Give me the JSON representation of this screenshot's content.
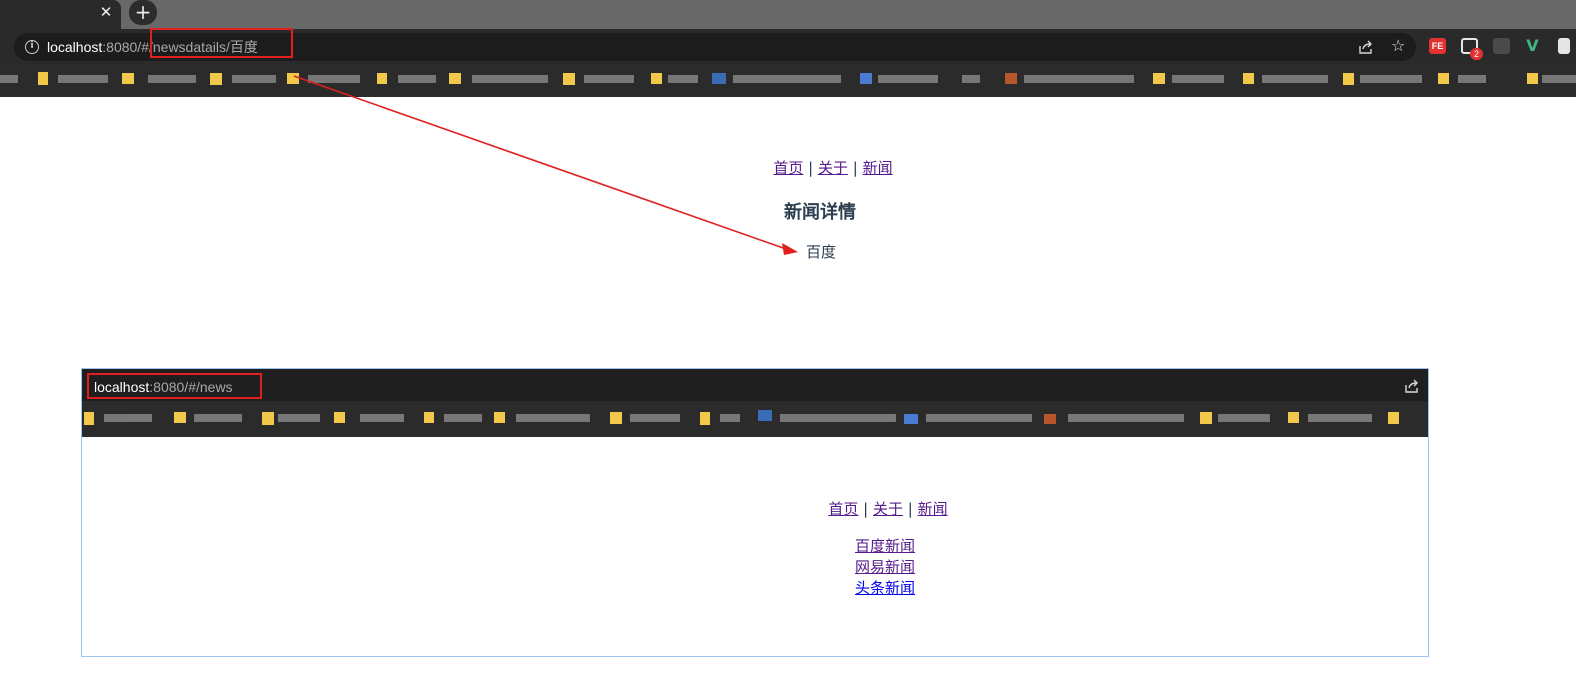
{
  "browser": {
    "tab_close_glyph": "✕",
    "new_tab_glyph": "+",
    "address": {
      "host": "localhost",
      "rest": ":8080/#/newsdatails/百度"
    },
    "star_glyph": "☆",
    "extensions": {
      "fe_label": "FE",
      "badge_count": "2",
      "vue_glyph": "V"
    }
  },
  "page": {
    "nav": {
      "home": "首页",
      "about": "关于",
      "news": "新闻",
      "separator": "|"
    },
    "title": "新闻详情",
    "detail_text": "百度"
  },
  "inset": {
    "address": {
      "host": "localhost",
      "rest": ":8080/#/news"
    },
    "nav": {
      "home": "首页",
      "about": "关于",
      "news": "新闻",
      "separator": "|"
    },
    "news_links": [
      "百度新闻",
      "网易新闻",
      "头条新闻"
    ]
  },
  "colors": {
    "annotation_red": "#e02020",
    "link_visited": "#551a8b",
    "link_unvisited": "#0000ee",
    "text": "#2c3e50"
  }
}
